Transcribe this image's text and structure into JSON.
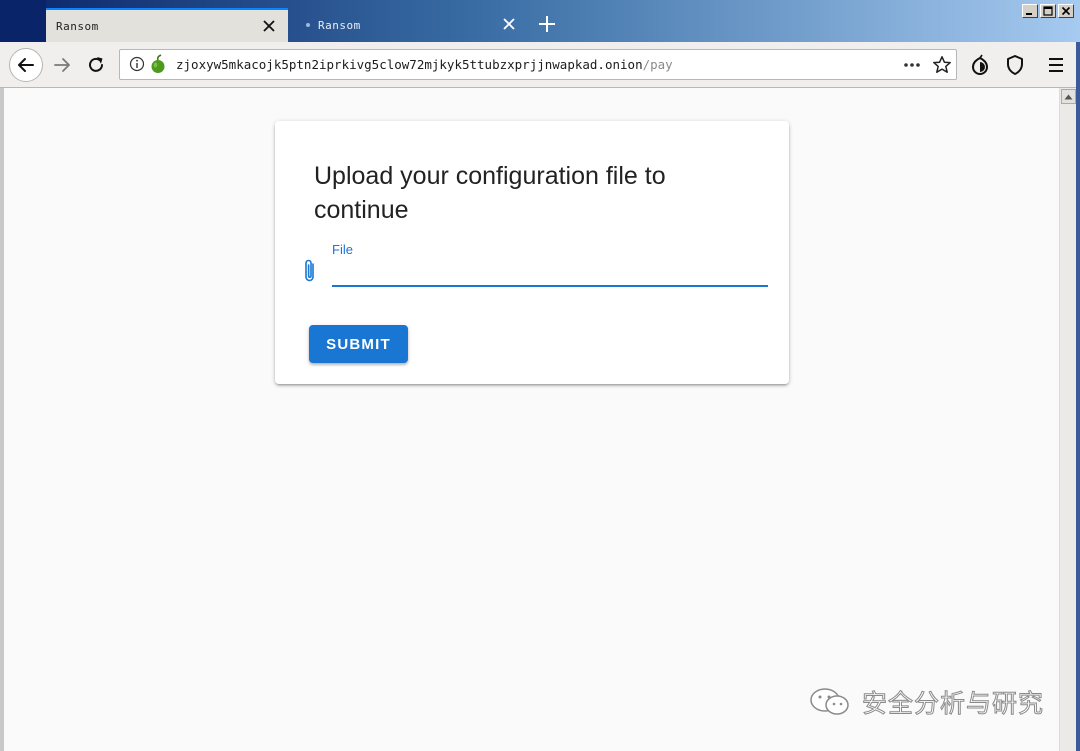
{
  "tabs": [
    {
      "title": "Ransom",
      "active": true
    },
    {
      "title": "Ransom",
      "active": false
    }
  ],
  "url": {
    "host": "zjoxyw5mkacojk5ptn2iprkivg5clow72mjkyk5ttubzxprjjnwapkad.onion",
    "path": "/pay"
  },
  "icons": {
    "back": "arrow-left-icon",
    "forward": "arrow-right-icon",
    "reload": "reload-icon",
    "info": "info-icon",
    "onion": "onion-icon",
    "page_actions": "ellipsis-icon",
    "bookmark": "star-icon",
    "tor": "tor-onion-icon",
    "shield": "shield-icon",
    "menu": "hamburger-menu-icon",
    "attach": "paperclip-icon"
  },
  "form": {
    "title": "Upload your configuration file to continue",
    "file_label": "File",
    "submit_label": "SUBMIT"
  },
  "watermark": {
    "text": "安全分析与研究"
  },
  "colors": {
    "accent": "#1976d2",
    "tab_indicator": "#0a84ff",
    "titlebar": "#0a246a"
  }
}
